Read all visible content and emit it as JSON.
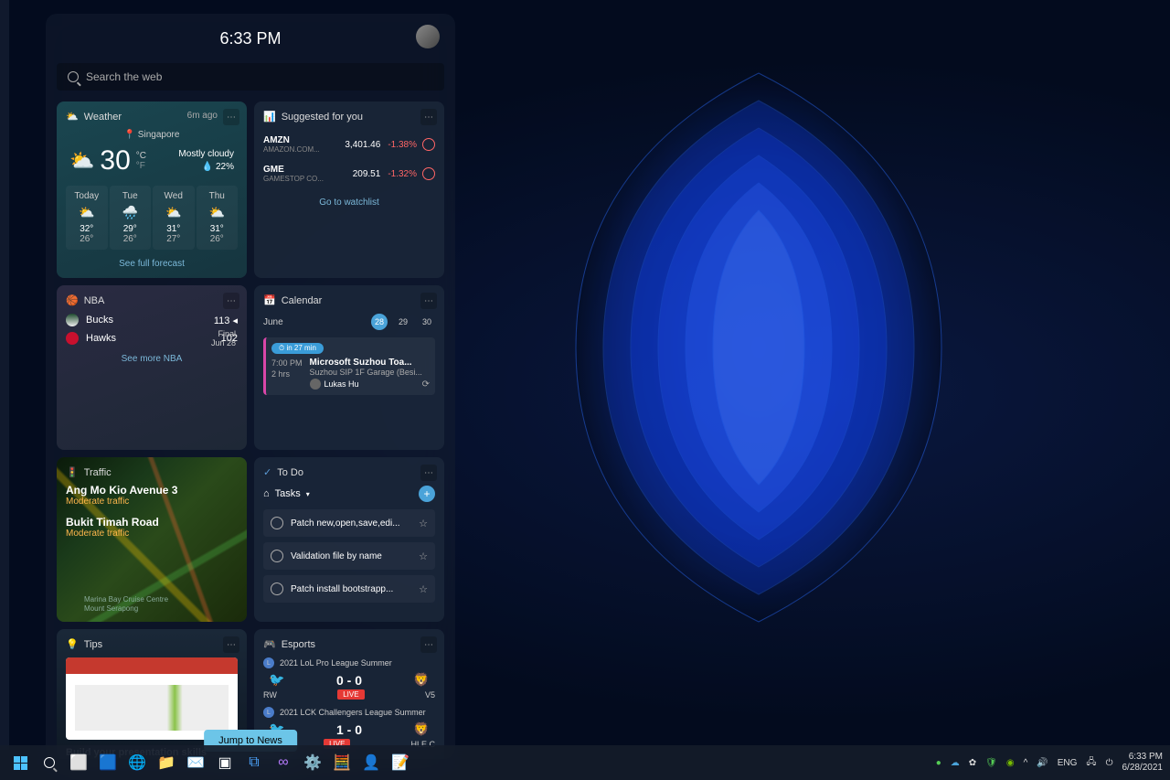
{
  "header": {
    "time": "6:33 PM"
  },
  "search": {
    "placeholder": "Search the web"
  },
  "weather": {
    "title": "Weather",
    "ago": "6m ago",
    "location": "📍 Singapore",
    "temp": "30",
    "unit_top": "°C",
    "unit_bot": "°F",
    "desc": "Mostly cloudy",
    "humidity": "💧 22%",
    "forecast": [
      {
        "d": "Today",
        "wi": "⛅",
        "hi": "32°",
        "lo": "26°"
      },
      {
        "d": "Tue",
        "wi": "🌧️",
        "hi": "29°",
        "lo": "26°"
      },
      {
        "d": "Wed",
        "wi": "⛅",
        "hi": "31°",
        "lo": "27°"
      },
      {
        "d": "Thu",
        "wi": "⛅",
        "hi": "31°",
        "lo": "26°"
      }
    ],
    "link": "See full forecast"
  },
  "suggested": {
    "title": "Suggested for you",
    "stocks": [
      {
        "sym": "AMZN",
        "name": "AMAZON.COM...",
        "price": "3,401.46",
        "chg": "-1.38%"
      },
      {
        "sym": "GME",
        "name": "GAMESTOP CO...",
        "price": "209.51",
        "chg": "-1.32%"
      }
    ],
    "link": "Go to watchlist"
  },
  "nba": {
    "title": "NBA",
    "teams": [
      {
        "name": "Bucks",
        "score": "113 ◂"
      },
      {
        "name": "Hawks",
        "score": "102"
      }
    ],
    "status": "Final",
    "date": "Jun 28",
    "link": "See more NBA"
  },
  "calendar": {
    "title": "Calendar",
    "month": "June",
    "days": [
      "28",
      "29",
      "30"
    ],
    "today": 0,
    "pill": "⏱ in 27 min",
    "event_time": "7:00 PM",
    "event_dur": "2 hrs",
    "event_title": "Microsoft Suzhou Toa...",
    "event_loc": "Suzhou SIP 1F Garage (Besi...",
    "event_person": "Lukas Hu"
  },
  "traffic": {
    "title": "Traffic",
    "routes": [
      {
        "name": "Ang Mo Kio Avenue 3",
        "status": "Moderate traffic"
      },
      {
        "name": "Bukit Timah Road",
        "status": "Moderate traffic"
      }
    ],
    "poi1": "Marina Bay Cruise Centre",
    "poi2": "Mount Serapong"
  },
  "todo": {
    "title": "To Do",
    "list_name": "Tasks",
    "tasks": [
      "Patch new,open,save,edi...",
      "Validation file by name",
      "Patch install bootstrapp..."
    ]
  },
  "tips": {
    "title": "Tips",
    "text": "Build your presentation skills"
  },
  "esports": {
    "title": "Esports",
    "leagues": [
      {
        "name": "2021 LoL Pro League Summer",
        "t1": "RW",
        "score": "0 - 0",
        "t2": "V5",
        "live": "LIVE"
      },
      {
        "name": "2021 LCK Challengers League Summer",
        "t1": "",
        "score": "1 - 0",
        "t2": "HLE.C",
        "live": "LIVE"
      }
    ]
  },
  "jump": "Jump to News",
  "systray": {
    "lang": "ENG",
    "time": "6:33 PM",
    "date": "6/28/2021"
  }
}
